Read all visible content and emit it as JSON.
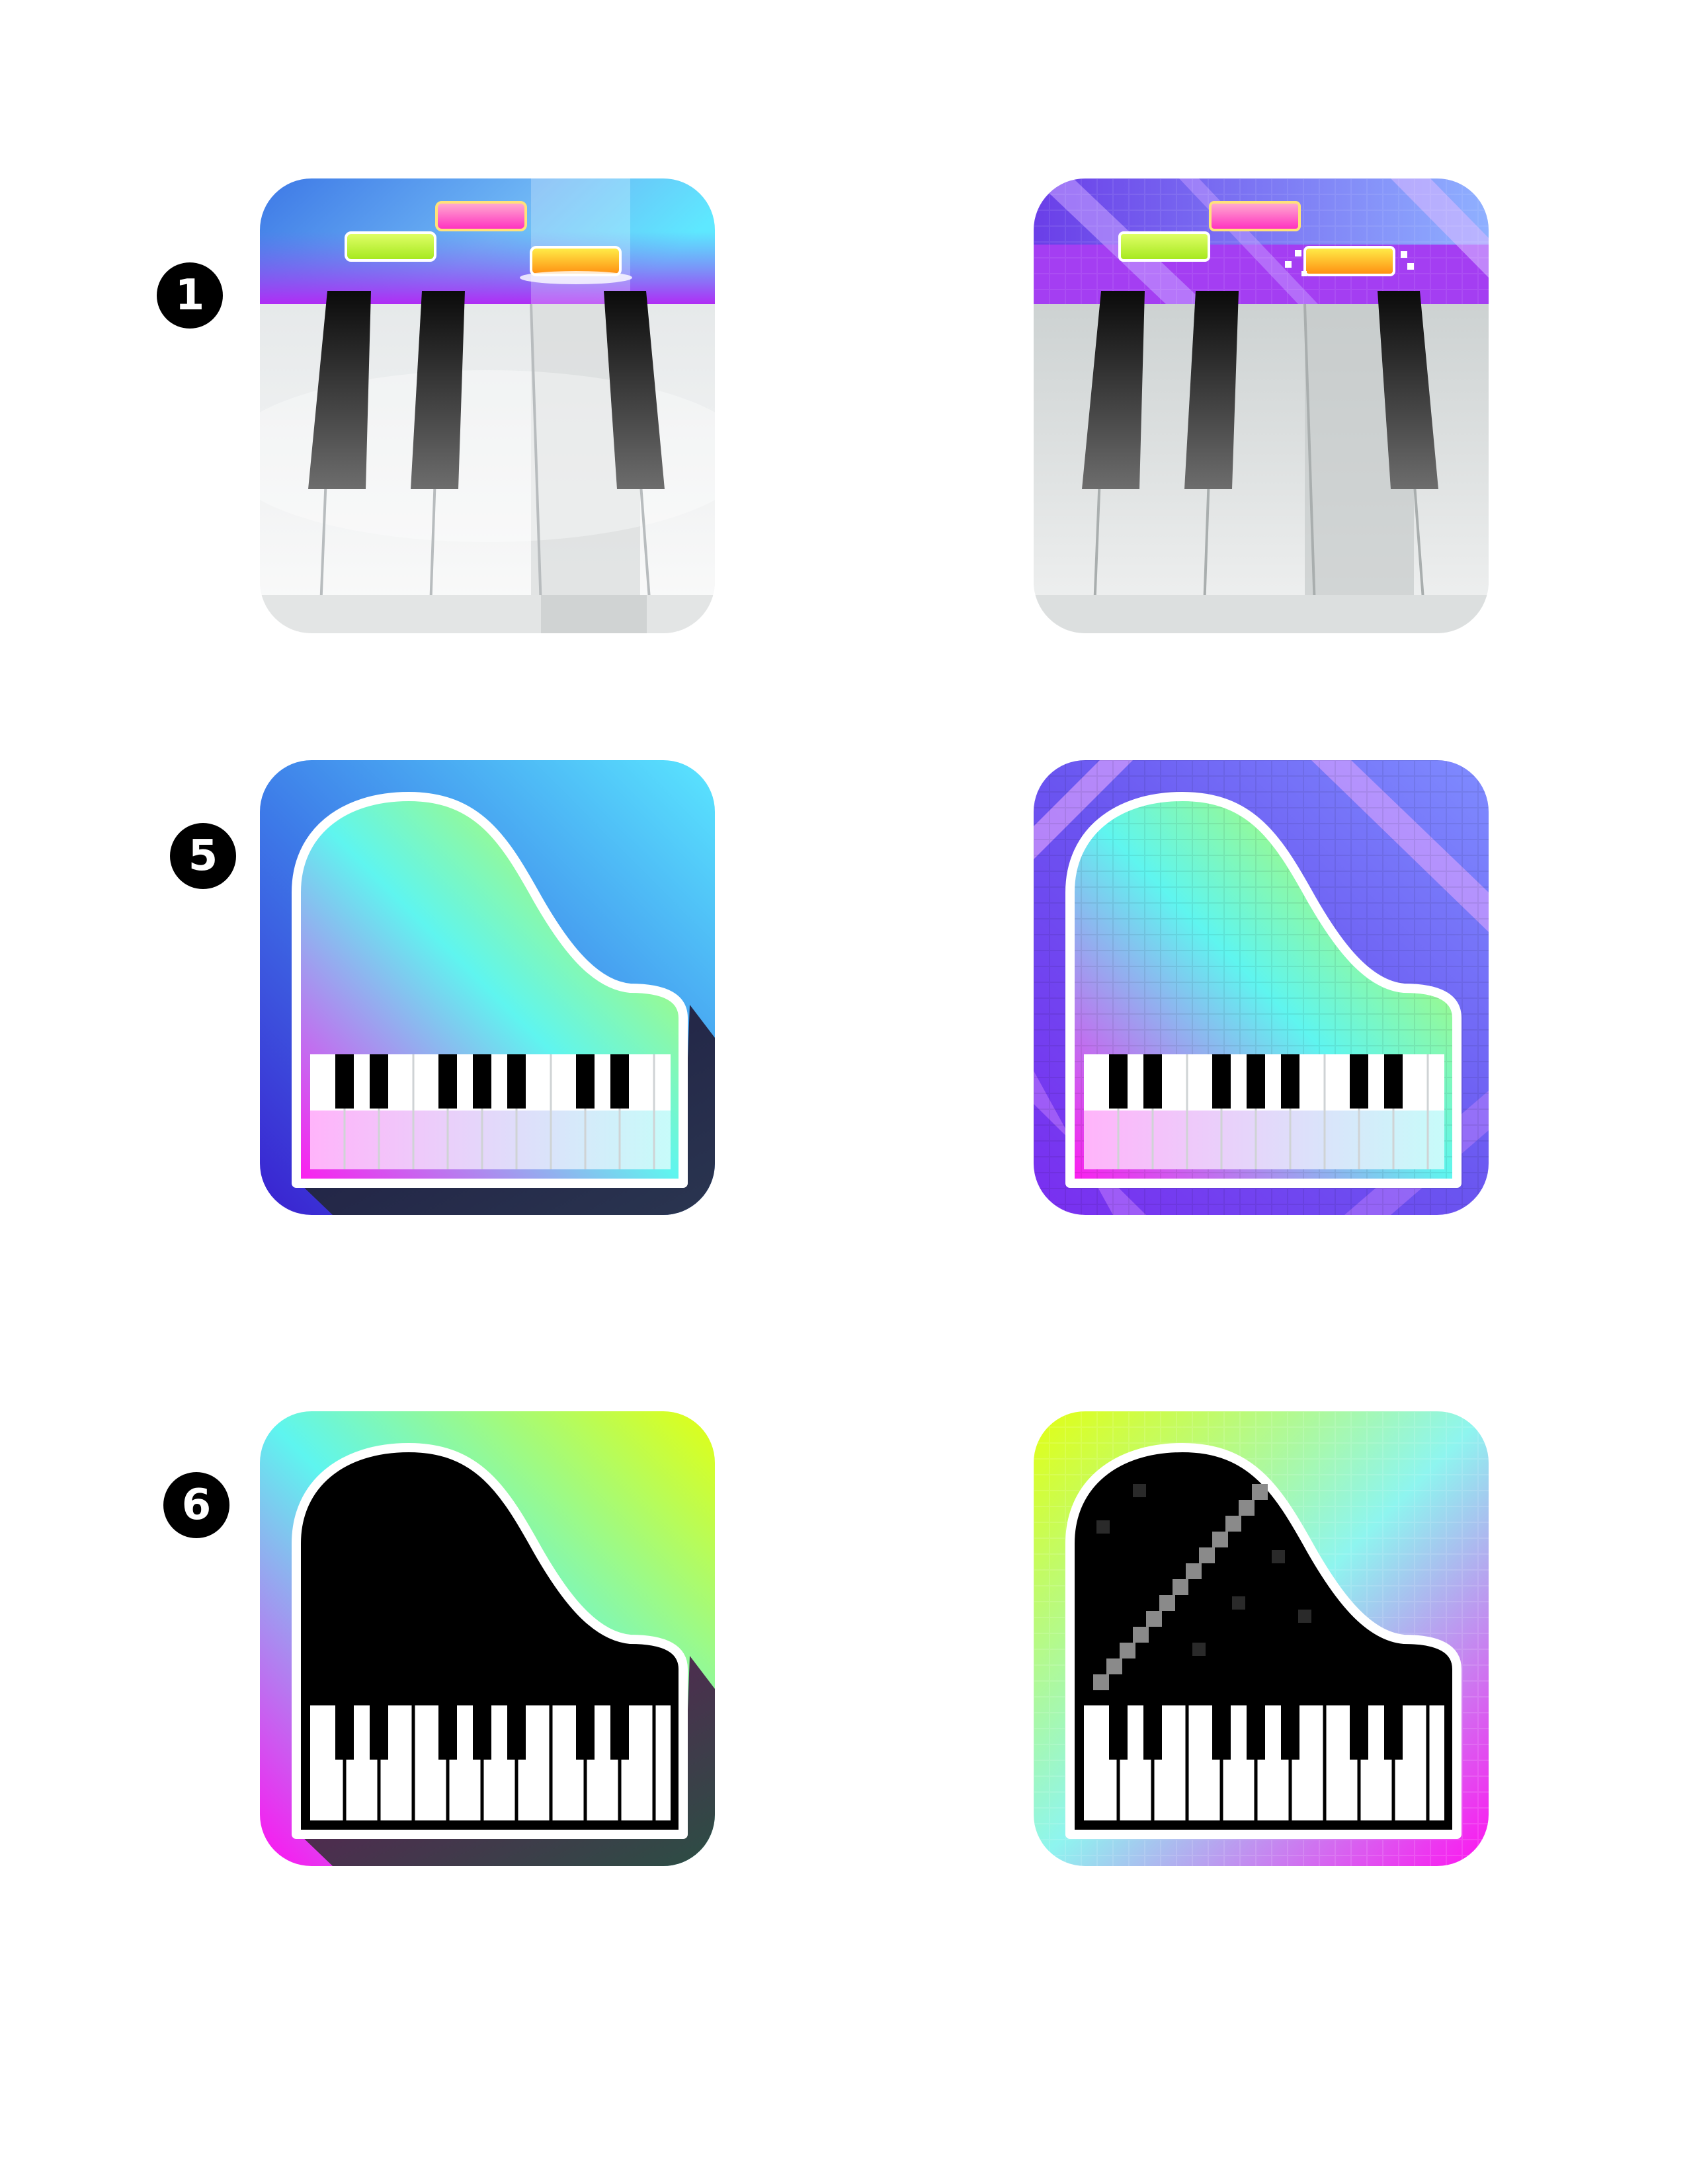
{
  "rows": [
    {
      "label": "1",
      "style": "piano-keys"
    },
    {
      "label": "5",
      "style": "grand-piano-gradient"
    },
    {
      "label": "6",
      "style": "grand-piano-black"
    }
  ],
  "columns": [
    "smooth",
    "pixelated"
  ],
  "colors": {
    "background": "#ffffff",
    "badge": "#000000",
    "magenta": "#ff19f0",
    "cyan": "#5ee8ff",
    "lime": "#d8ff1a",
    "violet": "#7a3cf0",
    "blue": "#3d7ae8"
  },
  "icons": {
    "row1_left": "piano-keys-icon",
    "row1_right": "piano-keys-pixel-icon",
    "row2_left": "grand-piano-gradient-icon",
    "row2_right": "grand-piano-gradient-pixel-icon",
    "row3_left": "grand-piano-black-icon",
    "row3_right": "grand-piano-black-pixel-icon"
  }
}
